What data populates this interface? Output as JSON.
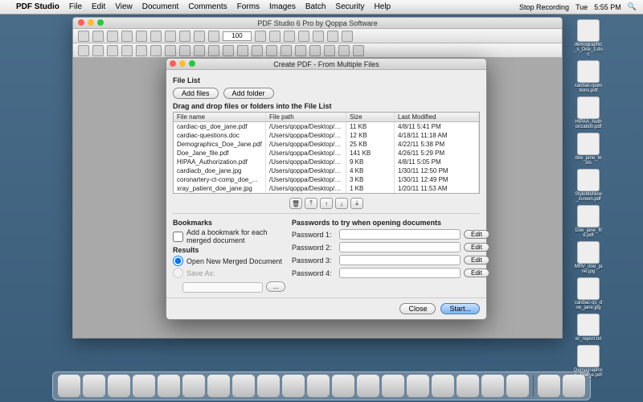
{
  "menubar": {
    "app": "PDF Studio",
    "items": [
      "File",
      "Edit",
      "View",
      "Document",
      "Comments",
      "Forms",
      "Images",
      "Batch",
      "Security",
      "Help"
    ],
    "stop_recording": "Stop Recording",
    "day": "Tue",
    "time": "5:55 PM"
  },
  "app_window": {
    "title": "PDF Studio 6 Pro by Qoppa Software",
    "zoom": "100"
  },
  "dialog": {
    "title": "Create PDF - From Multiple Files",
    "file_list_label": "File List",
    "add_files": "Add files",
    "add_folder": "Add folder",
    "instruction": "Drag and drop files or folders into the File List",
    "columns": {
      "name": "File name",
      "path": "File path",
      "size": "Size",
      "mod": "Last Modified"
    },
    "rows": [
      {
        "name": "cardiac-qs_doe_jane.pdf",
        "path": "/Users/qoppa/Desktop/ca...",
        "size": "11 KB",
        "mod": "4/8/11 5:41 PM"
      },
      {
        "name": "cardiac-questions.doc",
        "path": "/Users/qoppa/Desktop/ca...",
        "size": "12 KB",
        "mod": "4/18/11 11:18 AM"
      },
      {
        "name": "Demographics_Doe_Jane.pdf",
        "path": "/Users/qoppa/Desktop/De...",
        "size": "25 KB",
        "mod": "4/22/11 5:38 PM"
      },
      {
        "name": "Doe_Jane_file.pdf",
        "path": "/Users/qoppa/Desktop/Do...",
        "size": "141 KB",
        "mod": "4/26/11 5:29 PM"
      },
      {
        "name": "HIPAA_Authorization.pdf",
        "path": "/Users/qoppa/Desktop/HI...",
        "size": "9 KB",
        "mod": "4/8/11 5:05 PM"
      },
      {
        "name": "cardiacb_doe_jane.jpg",
        "path": "/Users/qoppa/Desktop/do...",
        "size": "4 KB",
        "mod": "1/30/11 12:50 PM"
      },
      {
        "name": "coronartery-ct-comp_doe_...",
        "path": "/Users/qoppa/Desktop/do...",
        "size": "3 KB",
        "mod": "1/30/11 12:49 PM"
      },
      {
        "name": "xray_patient_doe_jane.jpg",
        "path": "/Users/qoppa/Desktop/do...",
        "size": "1 KB",
        "mod": "1/20/11 11:53 AM"
      }
    ],
    "bookmarks_label": "Bookmarks",
    "bookmark_check": "Add a bookmark for each merged document",
    "results_label": "Results",
    "open_new": "Open New Merged Document",
    "save_as": "Save As:",
    "browse": "...",
    "passwords_label": "Passwords to try when opening documents",
    "pwd": [
      "Password 1:",
      "Password 2:",
      "Password 3:",
      "Password 4:"
    ],
    "edit": "Edit",
    "close": "Close",
    "start": "Start..."
  },
  "desktop": [
    "demographic_s_Doe_1.doc",
    "cardiac-questions.pdf",
    "HIPAA_Authorization.pdf",
    "doe_jane_tests",
    "StyleMeNow_screen.pdf",
    "Doe_jane_file.pdf",
    "MRV_doe_jane.jpg",
    "cardiac-qs_doe_jane.jpg",
    "er_report.txt",
    "Demographics_Doe_e.pdf"
  ]
}
